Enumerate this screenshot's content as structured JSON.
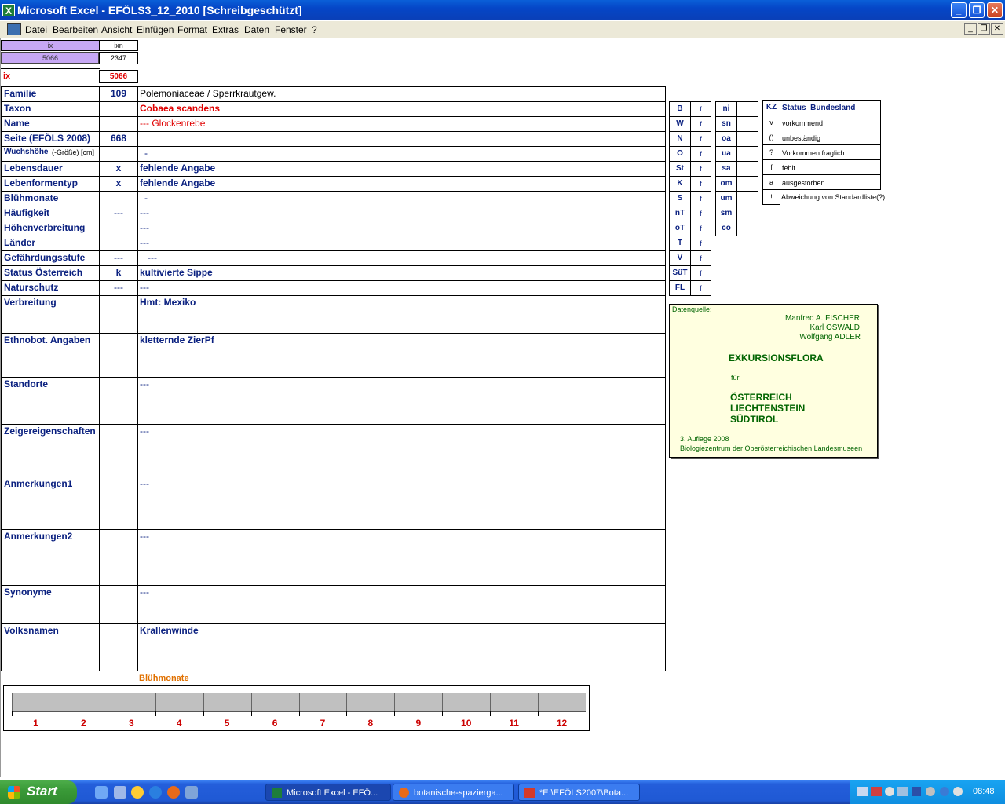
{
  "window": {
    "title": "Microsoft Excel - EFÖLS3_12_2010  [Schreibgeschützt]"
  },
  "menu": [
    "Datei",
    "Bearbeiten",
    "Ansicht",
    "Einfügen",
    "Format",
    "Extras",
    "Daten",
    "Fenster",
    "?"
  ],
  "index_box": {
    "h1": "ix",
    "h2": "ixn",
    "v1": "5066",
    "v2": "2347",
    "ix_label": "ix",
    "ix_value": "5066"
  },
  "rows": [
    {
      "label": "Familie",
      "mid": "109",
      "value": "Polemoniaceae  /  Sperrkrautgew."
    },
    {
      "label": "Taxon",
      "mid": "",
      "value": "Cobaea scandens"
    },
    {
      "label": "Name",
      "mid": "",
      "value": "--- Glockenrebe"
    },
    {
      "label": "Seite (EFÖLS 2008)",
      "mid": "668",
      "value": ""
    },
    {
      "label": "Wuchshöhe",
      "label_suffix": "(-Größe) [cm]",
      "mid": "",
      "value": "-"
    },
    {
      "label": "Lebensdauer",
      "mid": "x",
      "value": "fehlende Angabe"
    },
    {
      "label": "Lebenformentyp",
      "mid": "x",
      "value": "fehlende Angabe"
    },
    {
      "label": "Blühmonate",
      "mid": "",
      "value": "-"
    },
    {
      "label": "Häufigkeit",
      "mid": "---",
      "value": "---"
    },
    {
      "label": "Höhenverbreitung",
      "mid": "",
      "value": "---"
    },
    {
      "label": "Länder",
      "mid": "",
      "value": "---"
    },
    {
      "label": "Gefährdungsstufe",
      "mid": "---",
      "value": "---"
    },
    {
      "label": "Status Österreich",
      "mid": "k",
      "value": "kultivierte Sippe"
    },
    {
      "label": "Naturschutz",
      "mid": "---",
      "value": "---"
    },
    {
      "label": "Verbreitung",
      "mid": "",
      "value": "Hmt: Mexiko"
    },
    {
      "label": "Ethnobot. Angaben",
      "mid": "",
      "value": "kletternde ZierPf"
    },
    {
      "label": "Standorte",
      "mid": "",
      "value": "---"
    },
    {
      "label": "Zeigereigenschaften",
      "mid": "",
      "value": "---"
    },
    {
      "label": "Anmerkungen1",
      "mid": "",
      "value": "---"
    },
    {
      "label": "Anmerkungen2",
      "mid": "",
      "value": "---"
    },
    {
      "label": "Synonyme",
      "mid": "",
      "value": "---"
    },
    {
      "label": "Volksnamen",
      "mid": "",
      "value": "Krallenwinde"
    }
  ],
  "status_left": [
    {
      "k": "B",
      "v": "f"
    },
    {
      "k": "W",
      "v": "f"
    },
    {
      "k": "N",
      "v": "f"
    },
    {
      "k": "O",
      "v": "f"
    },
    {
      "k": "St",
      "v": "f"
    },
    {
      "k": "K",
      "v": "f"
    },
    {
      "k": "S",
      "v": "f"
    },
    {
      "k": "nT",
      "v": "f"
    },
    {
      "k": "oT",
      "v": "f"
    },
    {
      "k": "T",
      "v": "f"
    },
    {
      "k": "V",
      "v": "f"
    },
    {
      "k": "SüT",
      "v": "f"
    },
    {
      "k": "FL",
      "v": "f"
    }
  ],
  "status_mid": [
    "ni",
    "sn",
    "oa",
    "ua",
    "sa",
    "om",
    "um",
    "sm",
    "co"
  ],
  "legend": {
    "kz_header": "KZ",
    "title": "Status_Bundesland",
    "items": [
      {
        "kz": "v",
        "text": "vorkommend"
      },
      {
        "kz": "()",
        "text": "unbeständig"
      },
      {
        "kz": "?",
        "text": "Vorkommen fraglich"
      },
      {
        "kz": "f",
        "text": "fehlt"
      },
      {
        "kz": "a",
        "text": "ausgestorben"
      },
      {
        "kz": "!",
        "text": "Abweichung von Standardliste(?)"
      }
    ]
  },
  "source": {
    "label": "Datenquelle:",
    "authors": [
      "Manfred A. FISCHER",
      "Karl OSWALD",
      "Wolfgang ADLER"
    ],
    "book": "EXKURSIONSFLORA",
    "fuer": "für",
    "countries": [
      "ÖSTERREICH",
      "LIECHTENSTEIN",
      "SÜDTIROL"
    ],
    "edition": "3. Auflage 2008",
    "publisher": "Biologiezentrum der Oberösterreichischen Landesmuseen"
  },
  "bloom_chart": {
    "title": "Blühmonate",
    "months": [
      "1",
      "2",
      "3",
      "4",
      "5",
      "6",
      "7",
      "8",
      "9",
      "10",
      "11",
      "12"
    ],
    "bar_color": "#c0c0c0",
    "title_color": "#e07000",
    "month_color": "#cc0000"
  },
  "taskbar": {
    "start": "Start",
    "tasks": [
      "Microsoft Excel - EFÖ...",
      "botanische-spazierga...",
      "*E:\\EFÖLS2007\\Bota..."
    ],
    "time": "08:48"
  }
}
